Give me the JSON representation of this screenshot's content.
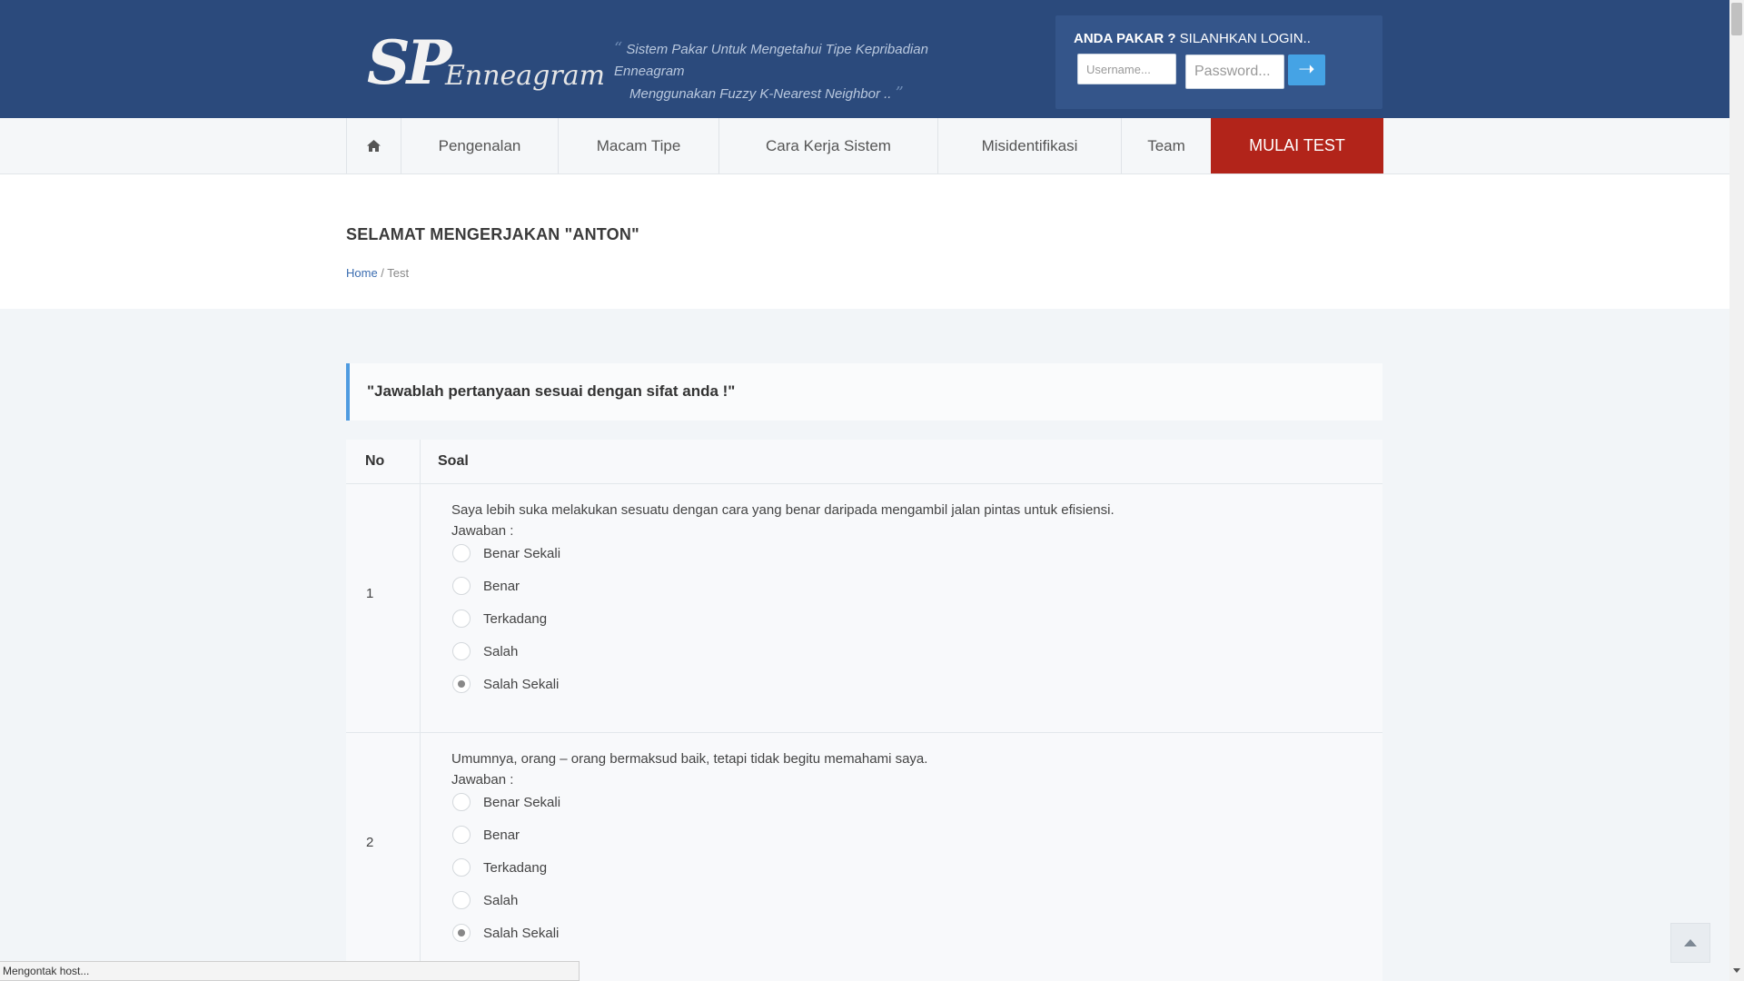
{
  "header": {
    "logo_main": "SP",
    "logo_sub": "Enneagram",
    "tagline_line1": "Sistem Pakar Untuk Mengetahui Tipe Kepribadian Enneagram",
    "tagline_line2": "Menggunakan Fuzzy K-Nearest Neighbor ..",
    "quote_open": "“",
    "quote_close": "”"
  },
  "login": {
    "title_bold": "ANDA PAKAR ?",
    "title_rest": " SILANHKAN LOGIN..",
    "username_placeholder": "Username...",
    "password_placeholder": "Password...",
    "submit_icon": "arrow-right-icon",
    "submit_glyph": "➝"
  },
  "nav": {
    "home_icon": "home-icon",
    "items": [
      "Pengenalan",
      "Macam Tipe",
      "Cara Kerja Sistem",
      "Misidentifikasi",
      "Team"
    ],
    "cta": "MULAI TEST",
    "cta_color": "#b2241a"
  },
  "page": {
    "title": "SELAMAT MENGERJAKAN \"ANTON\"",
    "breadcrumb_home": "Home",
    "breadcrumb_sep": " / ",
    "breadcrumb_current": "Test"
  },
  "notice": "\"Jawablah pertanyaan sesuai dengan sifat anda !\"",
  "table": {
    "headers": [
      "No",
      "Soal"
    ],
    "answer_label": "Jawaban :",
    "rows": [
      {
        "no": "1",
        "question": "Saya lebih suka melakukan sesuatu dengan cara yang benar daripada mengambil jalan pintas untuk efisiensi.",
        "options": [
          " Benar Sekali",
          "Benar",
          "Terkadang",
          "Salah",
          "Salah Sekali"
        ],
        "selected": "Salah Sekali"
      },
      {
        "no": "2",
        "question": "Umumnya, orang – orang bermaksud baik, tetapi tidak begitu memahami saya.",
        "options": [
          " Benar Sekali",
          "Benar",
          "Terkadang",
          "Salah",
          "Salah Sekali"
        ],
        "selected": "Salah Sekali"
      }
    ]
  },
  "status_bar": "Mengontak host...",
  "colors": {
    "header_bg": "#2b4a7c",
    "accent_blue": "#45a3e5",
    "notice_border": "#4f9be0"
  }
}
